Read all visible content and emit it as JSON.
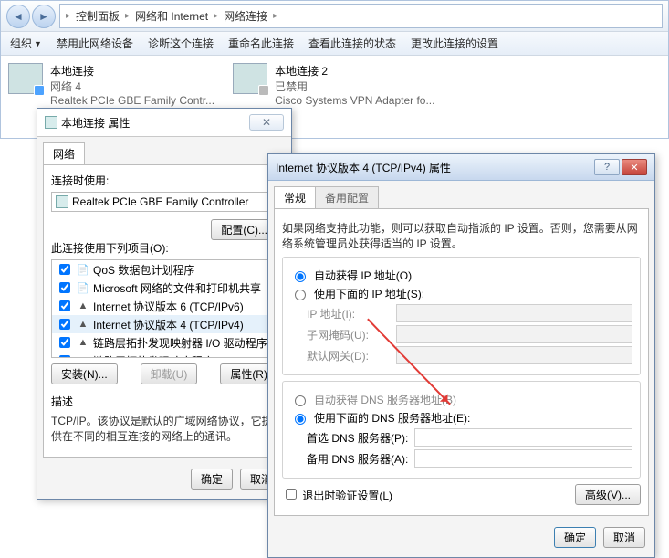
{
  "breadcrumbs": [
    "控制面板",
    "网络和 Internet",
    "网络连接"
  ],
  "toolbar": {
    "organize": "组织",
    "disable": "禁用此网络设备",
    "diagnose": "诊断这个连接",
    "rename": "重命名此连接",
    "status": "查看此连接的状态",
    "change": "更改此连接的设置"
  },
  "connections": [
    {
      "name": "本地连接",
      "status": "网络 4",
      "device": "Realtek PCIe GBE Family Contr..."
    },
    {
      "name": "本地连接 2",
      "status": "已禁用",
      "device": "Cisco Systems VPN Adapter fo..."
    }
  ],
  "dlg1": {
    "title": "本地连接 属性",
    "tab": "网络",
    "connect_label": "连接时使用:",
    "adapter": "Realtek PCIe GBE Family Controller",
    "configure": "配置(C)...",
    "items_label": "此连接使用下列项目(O):",
    "items": [
      "QoS 数据包计划程序",
      "Microsoft 网络的文件和打印机共享",
      "Internet 协议版本 6 (TCP/IPv6)",
      "Internet 协议版本 4 (TCP/IPv4)",
      "链路层拓扑发现映射器 I/O 驱动程序",
      "链路层拓扑发现响应程序"
    ],
    "install": "安装(N)...",
    "uninstall": "卸载(U)",
    "properties": "属性(R)",
    "desc_label": "描述",
    "desc_text": "TCP/IP。该协议是默认的广域网络协议，它提供在不同的相互连接的网络上的通讯。",
    "ok": "确定",
    "cancel": "取消"
  },
  "dlg2": {
    "title": "Internet 协议版本 4 (TCP/IPv4) 属性",
    "tabs": [
      "常规",
      "备用配置"
    ],
    "intro": "如果网络支持此功能，则可以获取自动指派的 IP 设置。否则，您需要从网络系统管理员处获得适当的 IP 设置。",
    "ip_auto": "自动获得 IP 地址(O)",
    "ip_manual": "使用下面的 IP 地址(S):",
    "ip_addr": "IP 地址(I):",
    "subnet": "子网掩码(U):",
    "gateway": "默认网关(D):",
    "dns_auto": "自动获得 DNS 服务器地址(B)",
    "dns_manual": "使用下面的 DNS 服务器地址(E):",
    "dns_pref": "首选 DNS 服务器(P):",
    "dns_alt": "备用 DNS 服务器(A):",
    "validate": "退出时验证设置(L)",
    "advanced": "高级(V)...",
    "ok": "确定",
    "cancel": "取消"
  }
}
